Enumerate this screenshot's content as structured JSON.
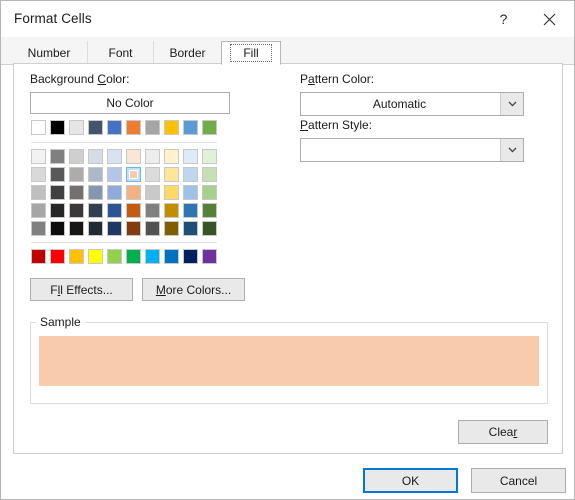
{
  "window": {
    "title": "Format Cells",
    "help_icon": "question-mark-icon",
    "close_icon": "close-icon"
  },
  "tabs": [
    {
      "label": "Number",
      "active": false
    },
    {
      "label": "Font",
      "active": false
    },
    {
      "label": "Border",
      "active": false
    },
    {
      "label": "Fill",
      "active": true
    }
  ],
  "fill": {
    "background_color_label": "Background Color:",
    "background_color_accesskey": "C",
    "no_color_label": "No Color",
    "fill_effects_label": "Fill Effects...",
    "fill_effects_accesskey": "l",
    "more_colors_label": "More Colors...",
    "more_colors_accesskey": "M",
    "pattern_color_label": "Pattern Color:",
    "pattern_color_accesskey": "a",
    "pattern_color_value": "Automatic",
    "pattern_style_label": "Pattern Style:",
    "pattern_style_accesskey": "P",
    "pattern_style_value": "",
    "sample_label": "Sample",
    "sample_color": "#F7CBAC",
    "clear_label": "Clear",
    "clear_accesskey": "r",
    "selected_swatch": {
      "row": 1,
      "col": 5,
      "color": "#F7CBAC"
    }
  },
  "palette": {
    "theme_row": [
      "#FFFFFF",
      "#000000",
      "#E7E6E6",
      "#44546A",
      "#4472C4",
      "#ED7D31",
      "#A5A5A5",
      "#FFC000",
      "#5B9BD5",
      "#70AD47"
    ],
    "tint_rows": [
      [
        "#F2F2F2",
        "#808080",
        "#D0CECE",
        "#D6DCE4",
        "#D9E2F3",
        "#FBE5D6",
        "#EDEDED",
        "#FFF2CC",
        "#DEEBF6",
        "#E2EFD9"
      ],
      [
        "#D9D9D9",
        "#595959",
        "#AEABAB",
        "#ACB9CA",
        "#B4C6E7",
        "#F7CBAC",
        "#DBDBDB",
        "#FFE599",
        "#BDD7EE",
        "#C5E0B3"
      ],
      [
        "#BFBFBF",
        "#404040",
        "#757070",
        "#8496B0",
        "#8FAADC",
        "#F4B183",
        "#C9C9C9",
        "#FFD965",
        "#9CC3E5",
        "#A8D08D"
      ],
      [
        "#A6A6A6",
        "#262626",
        "#3A3838",
        "#333F4F",
        "#2F5496",
        "#C55A11",
        "#808080",
        "#BF8F00",
        "#2E75B5",
        "#538135"
      ],
      [
        "#808080",
        "#0D0D0D",
        "#171616",
        "#222A35",
        "#1F3863",
        "#833C0B",
        "#525252",
        "#7F5F00",
        "#1F4E78",
        "#375623"
      ]
    ],
    "standard_row": [
      "#C00000",
      "#FF0000",
      "#FFC000",
      "#FFFF00",
      "#92D050",
      "#00B050",
      "#00B0F0",
      "#0070C0",
      "#002060",
      "#7030A0"
    ]
  },
  "footer": {
    "ok_label": "OK",
    "cancel_label": "Cancel"
  },
  "colors": {
    "accent": "#0078D7",
    "button_face": "#E9E9E9",
    "border": "#ADADAD"
  }
}
